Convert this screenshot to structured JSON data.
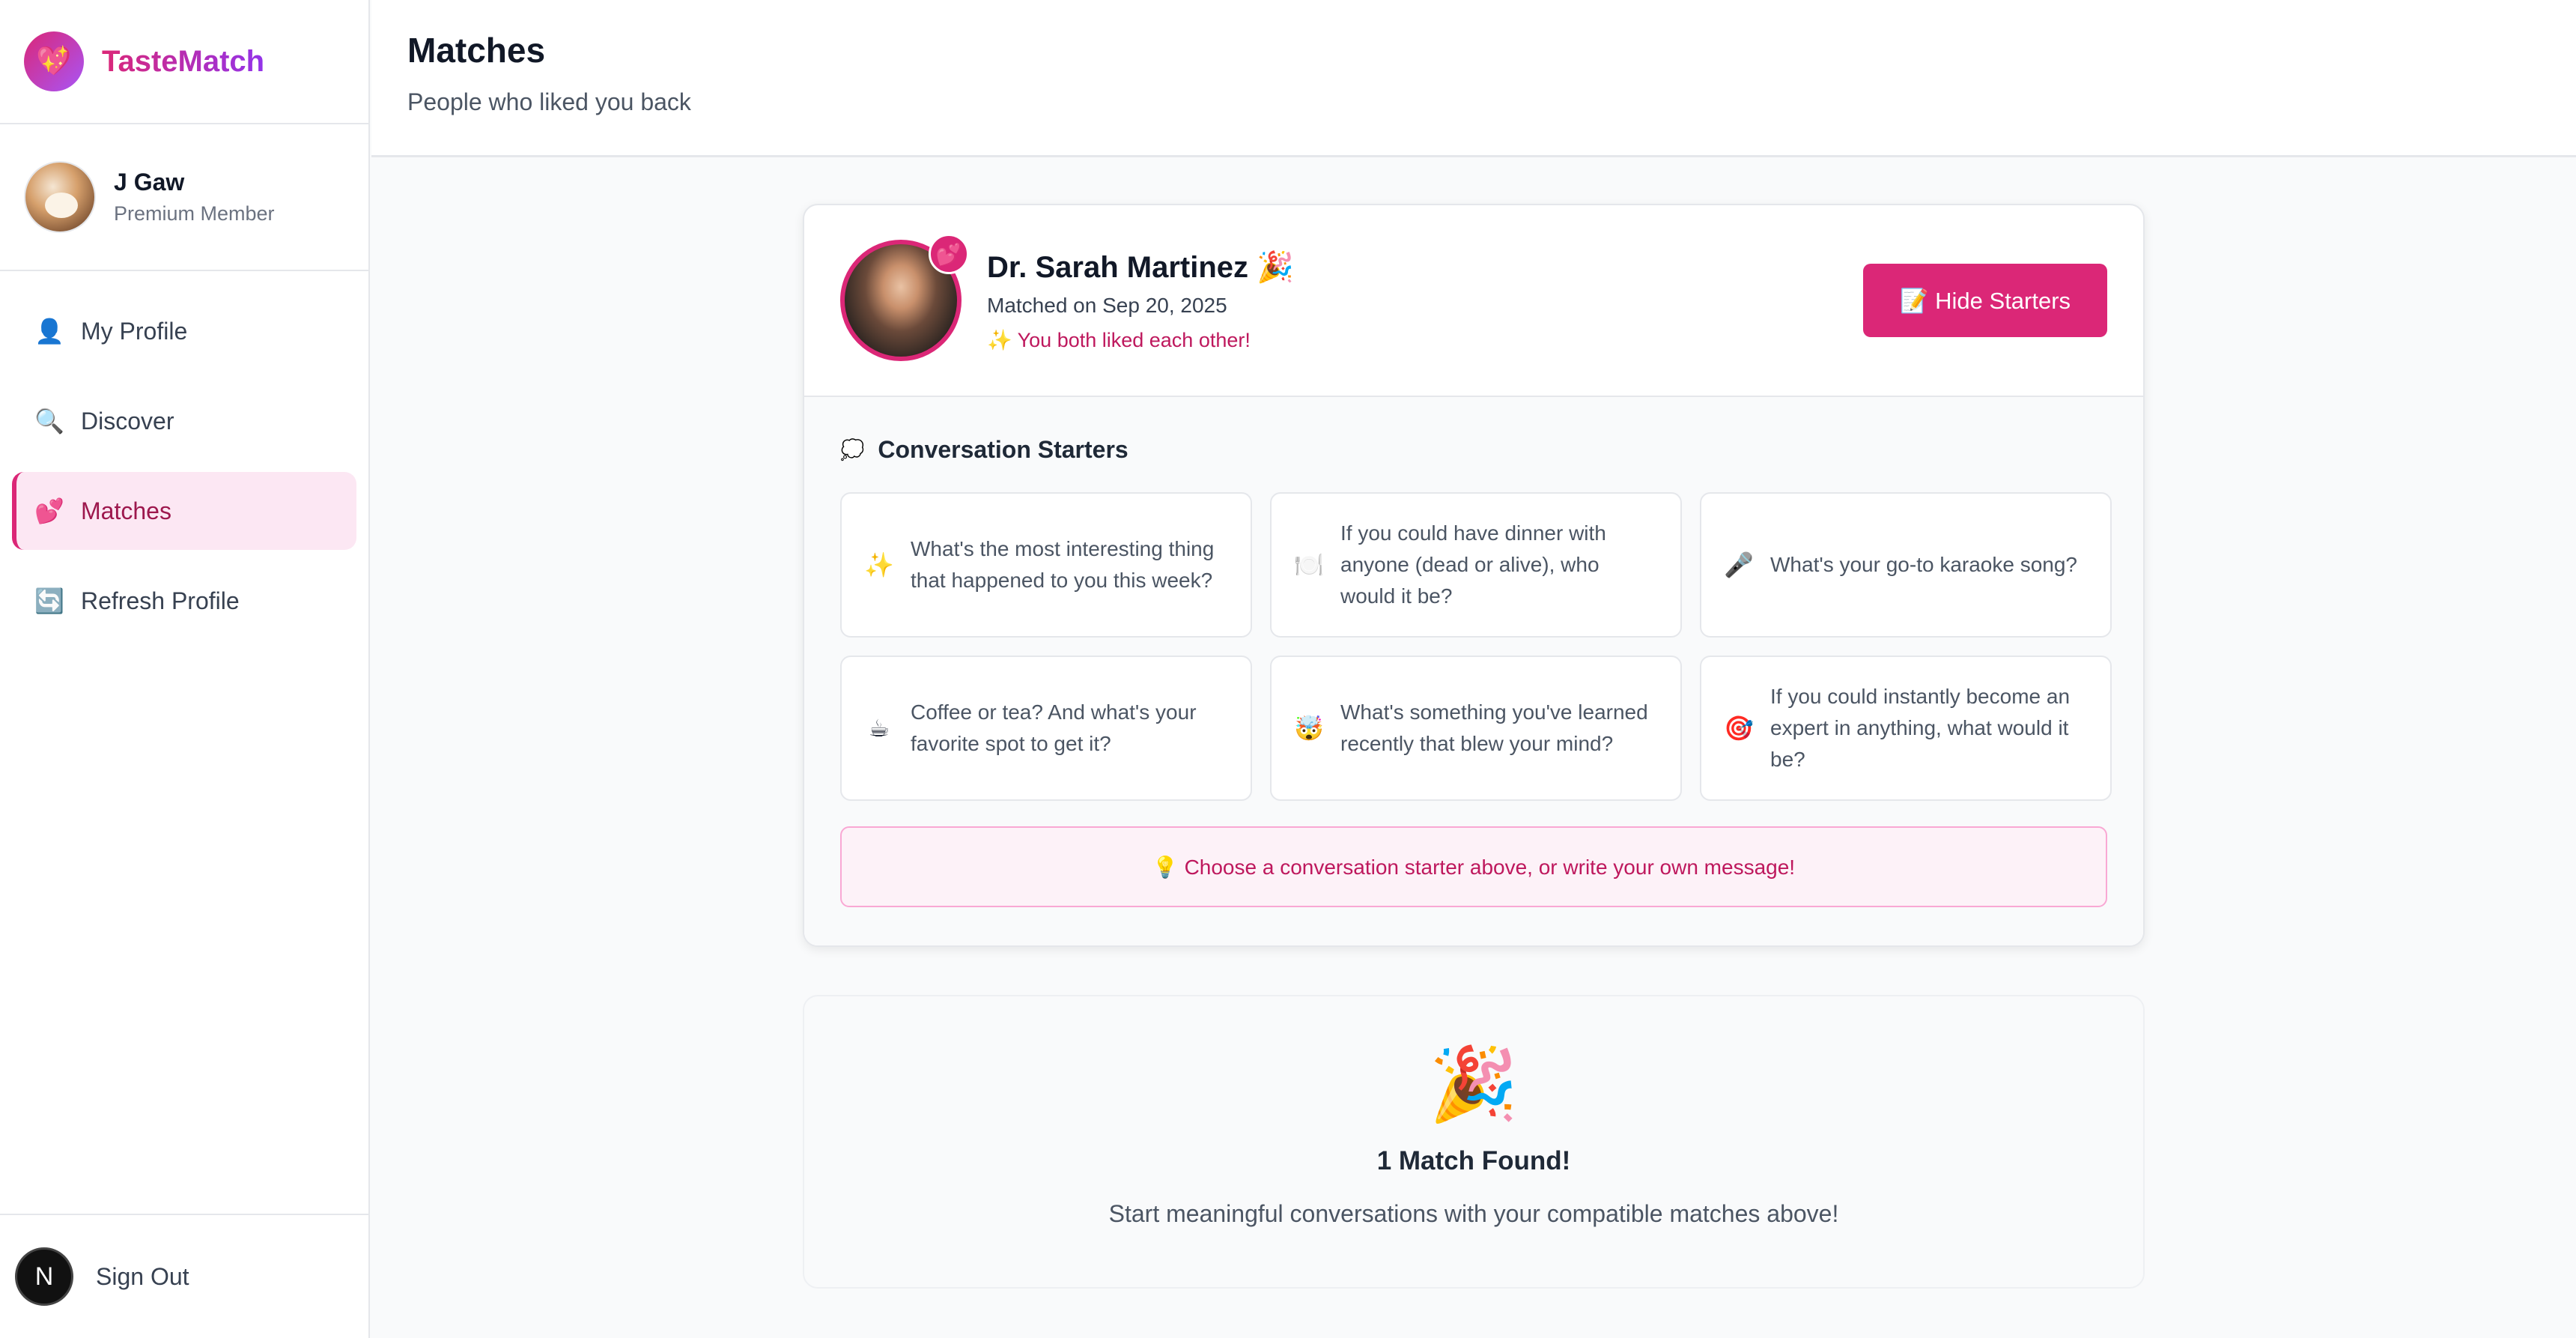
{
  "app": {
    "name": "TasteMatch",
    "logo_icon": "💖"
  },
  "user": {
    "name": "J Gaw",
    "role": "Premium Member"
  },
  "nav": {
    "items": [
      {
        "icon": "👤",
        "label": "My Profile"
      },
      {
        "icon": "🔍",
        "label": "Discover"
      },
      {
        "icon": "💕",
        "label": "Matches"
      },
      {
        "icon": "🔄",
        "label": "Refresh Profile"
      }
    ],
    "active": "Matches"
  },
  "footer": {
    "badge": "N",
    "signout_label": "Sign Out"
  },
  "header": {
    "title": "Matches",
    "subtitle": "People who liked you back"
  },
  "match": {
    "name": "Dr. Sarah Martinez 🎉",
    "matched_on": "Matched on Sep 20, 2025",
    "mutual": "✨ You both liked each other!",
    "heart_icon": "💕",
    "hide_label": "📝 Hide Starters"
  },
  "starters": {
    "title": "Conversation Starters",
    "title_icon": "💭",
    "items": [
      {
        "icon": "✨",
        "text": "What's the most interesting thing that happened to you this week?"
      },
      {
        "icon": "🍽️",
        "text": "If you could have dinner with anyone (dead or alive), who would it be?"
      },
      {
        "icon": "🎤",
        "text": "What's your go-to karaoke song?"
      },
      {
        "icon": "☕",
        "text": "Coffee or tea? And what's your favorite spot to get it?"
      },
      {
        "icon": "🤯",
        "text": "What's something you've learned recently that blew your mind?"
      },
      {
        "icon": "🎯",
        "text": "If you could instantly become an expert in anything, what would it be?"
      }
    ],
    "tip": "💡 Choose a conversation starter above, or write your own message!"
  },
  "summary": {
    "icon": "🎉",
    "title": "1 Match Found!",
    "text": "Start meaningful conversations with your compatible matches above!"
  },
  "colors": {
    "accent": "#db2777",
    "accent_light": "#fce7f3",
    "text_dark": "#111827"
  }
}
